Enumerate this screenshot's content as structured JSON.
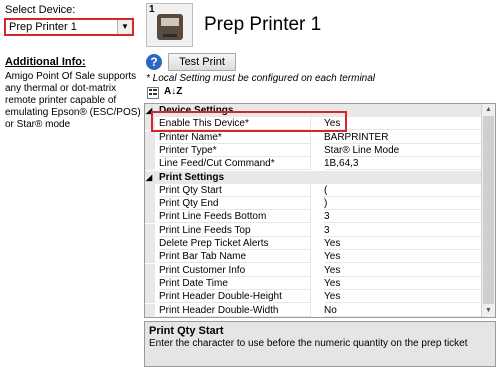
{
  "left_panel": {
    "select_label": "Select Device:",
    "selected_device": "Prep Printer 1",
    "additional_info_title": "Additional Info:",
    "additional_info_text": "Amigo Point Of Sale supports any thermal or dot-matrix remote printer capable of emulating Epson® (ESC/POS) or Star® mode"
  },
  "header": {
    "device_number": "1",
    "device_title": "Prep Printer 1",
    "test_button": "Test Print",
    "local_note": "* Local Setting must be configured on each terminal"
  },
  "grid": {
    "rows": [
      {
        "type": "category",
        "name": "Device Settings"
      },
      {
        "type": "prop",
        "name": "Enable This Device*",
        "value": "Yes"
      },
      {
        "type": "prop",
        "name": "Printer Name*",
        "value": "BARPRINTER"
      },
      {
        "type": "prop",
        "name": "Printer Type*",
        "value": "Star® Line Mode"
      },
      {
        "type": "prop",
        "name": "Line Feed/Cut Command*",
        "value": "1B,64,3"
      },
      {
        "type": "category",
        "name": "Print Settings"
      },
      {
        "type": "prop",
        "name": "Print Qty Start",
        "value": "("
      },
      {
        "type": "prop",
        "name": "Print Qty End",
        "value": ")"
      },
      {
        "type": "prop",
        "name": "Print Line Feeds Bottom",
        "value": "3"
      },
      {
        "type": "prop",
        "name": "Print Line Feeds Top",
        "value": "3"
      },
      {
        "type": "prop",
        "name": "Delete Prep Ticket Alerts",
        "value": "Yes"
      },
      {
        "type": "prop",
        "name": "Print Bar Tab Name",
        "value": "Yes"
      },
      {
        "type": "prop",
        "name": "Print Customer Info",
        "value": "Yes"
      },
      {
        "type": "prop",
        "name": "Print Date Time",
        "value": "Yes"
      },
      {
        "type": "prop",
        "name": "Print Header Double-Height",
        "value": "Yes"
      },
      {
        "type": "prop",
        "name": "Print Header Double-Width",
        "value": "No"
      }
    ]
  },
  "description": {
    "title": "Print Qty Start",
    "text": "Enter the character to use before the numeric quantity on the prep ticket"
  },
  "colors": {
    "highlight_border": "#d4262b",
    "category_bg": "#e8e8e8",
    "help_icon": "#2b68c4"
  }
}
